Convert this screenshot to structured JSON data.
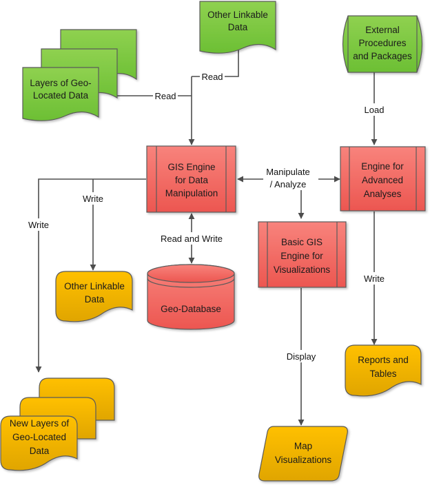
{
  "colors": {
    "green_top": "#8fd150",
    "green_bottom": "#6cbf34",
    "red_top": "#f8837c",
    "red_bottom": "#ec5650",
    "orange_top": "#ffc000",
    "orange_bottom": "#e0a500",
    "line": "#4d4d4d"
  },
  "nodes": {
    "layers_geo": {
      "lines": [
        "Layers of Geo-",
        "Located Data"
      ]
    },
    "other_linkable_in": {
      "lines": [
        "Other Linkable",
        "Data"
      ]
    },
    "external": {
      "lines": [
        "External",
        "Procedures",
        "and Packages"
      ]
    },
    "gis_engine": {
      "lines": [
        "GIS Engine",
        "for Data",
        "Manipulation"
      ]
    },
    "advanced": {
      "lines": [
        "Engine for",
        "Advanced",
        "Analyses"
      ]
    },
    "basic_vis": {
      "lines": [
        "Basic GIS",
        "Engine for",
        "Visualizations"
      ]
    },
    "geo_db": {
      "lines": [
        "Geo-Database"
      ]
    },
    "other_linkable_out": {
      "lines": [
        "Other Linkable",
        "Data"
      ]
    },
    "new_layers": {
      "lines": [
        "New Layers of",
        "Geo-Located",
        "Data"
      ]
    },
    "reports": {
      "lines": [
        "Reports and",
        "Tables"
      ]
    },
    "map_vis": {
      "lines": [
        "Map",
        "Visualizations"
      ]
    }
  },
  "edges": {
    "read_layers": "Read",
    "read_other": "Read",
    "load": "Load",
    "manipulate": [
      "Manipulate",
      "/ Analyze"
    ],
    "read_write": "Read and Write",
    "write_other": "Write",
    "write_layers": "Write",
    "write_reports": "Write",
    "display": "Display"
  }
}
